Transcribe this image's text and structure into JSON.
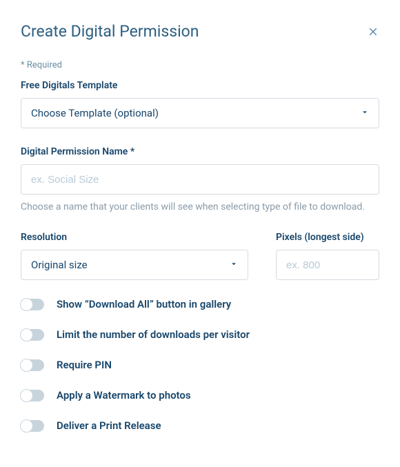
{
  "header": {
    "title": "Create Digital Permission"
  },
  "required_note": "* Required",
  "fields": {
    "template": {
      "label": "Free Digitals Template",
      "selected": "Choose Template (optional)"
    },
    "name": {
      "label": "Digital Permission Name *",
      "placeholder": "ex. Social Size",
      "helper": "Choose a name that your clients will see when selecting type of file to download."
    },
    "resolution": {
      "label": "Resolution",
      "selected": "Original size"
    },
    "pixels": {
      "label": "Pixels (longest side)",
      "placeholder": "ex. 800"
    }
  },
  "toggles": {
    "download_all": "Show “Download All” button in gallery",
    "limit_downloads": "Limit the number of downloads per visitor",
    "require_pin": "Require PIN",
    "watermark": "Apply a Watermark to photos",
    "print_release": "Deliver a Print Release"
  }
}
